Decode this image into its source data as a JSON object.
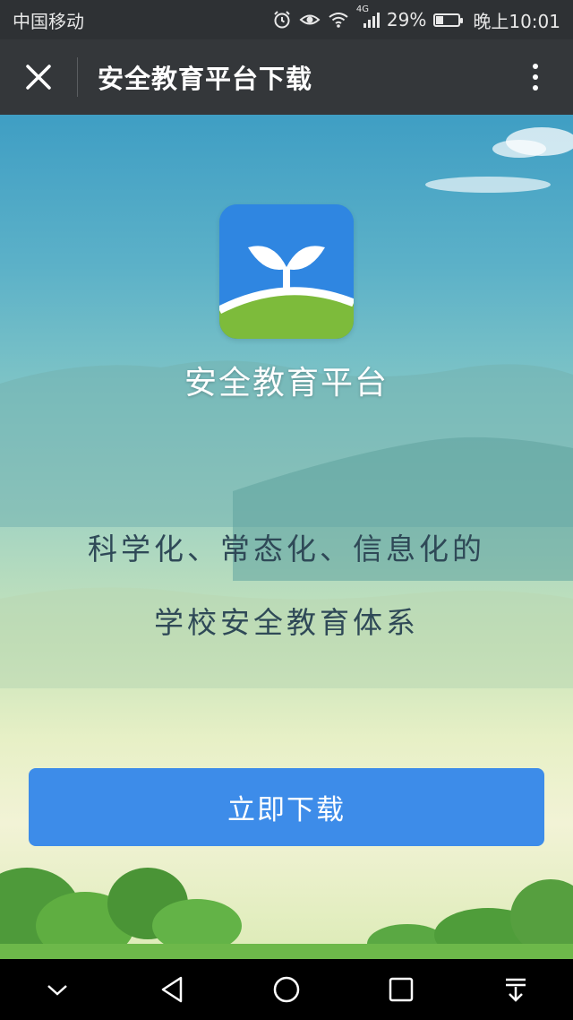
{
  "status_bar": {
    "carrier": "中国移动",
    "network": "4G",
    "battery_percent": "29%",
    "battery_level": 0.29,
    "time": "晚上10:01",
    "icons": [
      "alarm-icon",
      "eye-icon",
      "wifi-icon",
      "signal-icon",
      "battery-icon"
    ]
  },
  "title_bar": {
    "title": "安全教育平台下载",
    "close_icon": "close-icon",
    "more_icon": "more-vertical-icon"
  },
  "content": {
    "app_name": "安全教育平台",
    "app_icon": "sprout-app-icon",
    "slogan_line1": "科学化、常态化、信息化的",
    "slogan_line2": "学校安全教育体系",
    "download_label": "立即下载"
  },
  "colors": {
    "accent": "#3d8ce9",
    "title_bar": "#34373a",
    "status_bar": "#2e3134",
    "icon_blue": "#2f86e1",
    "icon_green": "#7dbb3b"
  },
  "nav_bar": {
    "icons": [
      "chevron-down-icon",
      "back-icon",
      "home-icon",
      "recents-icon",
      "notification-pull-icon"
    ]
  }
}
